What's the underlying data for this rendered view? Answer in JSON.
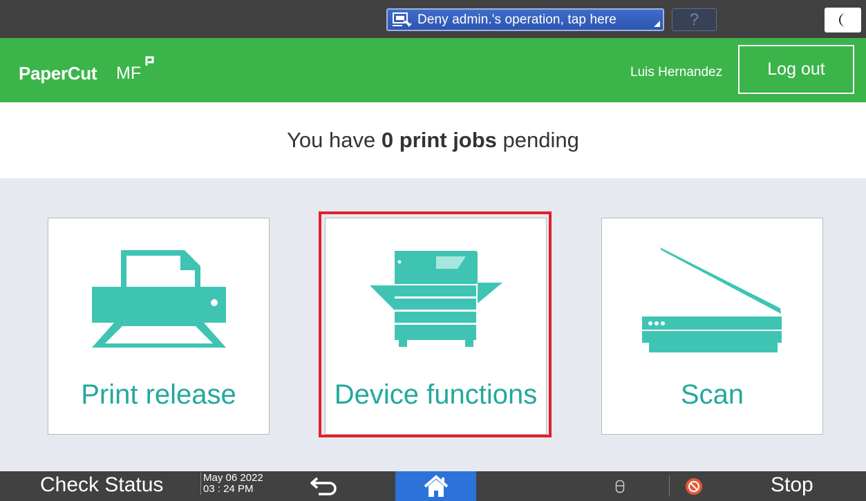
{
  "sysbar": {
    "deny_label": "Deny admin.'s operation, tap here",
    "deny_icon": "remote-operation-icon",
    "help_label": "?",
    "mode_icon": "moon-icon"
  },
  "header": {
    "logo_main": "PaperCut",
    "logo_mf": "MF",
    "username": "Luis Hernandez",
    "logout_label": "Log out",
    "bg_color": "#3bb44a"
  },
  "pending": {
    "prefix": "You have ",
    "count_text": "0 print jobs",
    "suffix": " pending"
  },
  "tiles": [
    {
      "label": "Print release",
      "icon": "printer-icon"
    },
    {
      "label": "Device functions",
      "icon": "copier-icon"
    },
    {
      "label": "Scan",
      "icon": "scanner-icon"
    }
  ],
  "highlight_color": "#e2202a",
  "accent_color": "#3fc4b4",
  "bottombar": {
    "check_status": "Check Status",
    "date": "May 06 2022",
    "time": "03 : 24 PM",
    "back_icon": "back-arrow-icon",
    "home_icon": "home-icon",
    "data_icon": "data-indicator-icon",
    "stop_icon": "stop-icon",
    "stop_label": "Stop"
  }
}
